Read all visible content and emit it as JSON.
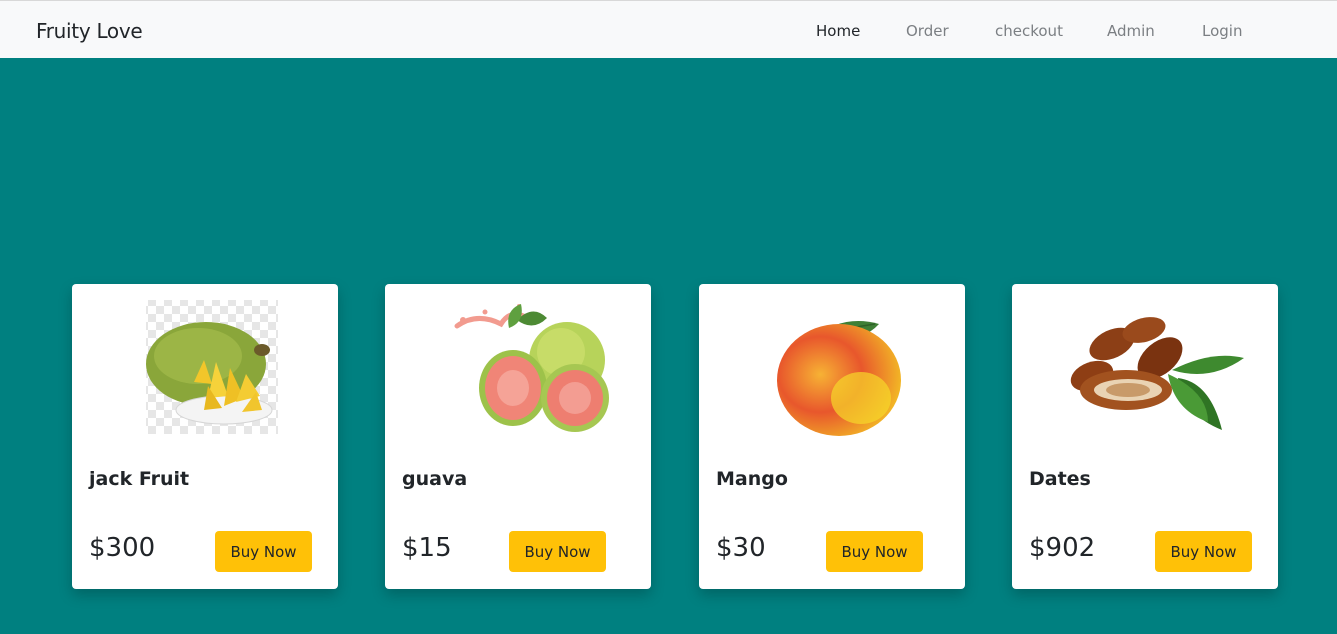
{
  "navbar": {
    "brand": "Fruity Love",
    "links": [
      {
        "label": "Home",
        "active": true
      },
      {
        "label": "Order",
        "active": false
      },
      {
        "label": "checkout",
        "active": false
      },
      {
        "label": "Admin",
        "active": false
      },
      {
        "label": "Login",
        "active": false
      }
    ]
  },
  "products": [
    {
      "name": "jack Fruit",
      "price": "$300",
      "button": "Buy Now",
      "image": "jackfruit-image"
    },
    {
      "name": "guava",
      "price": "$15",
      "button": "Buy Now",
      "image": "guava-image"
    },
    {
      "name": "Mango",
      "price": "$30",
      "button": "Buy Now",
      "image": "mango-image"
    },
    {
      "name": "Dates",
      "price": "$902",
      "button": "Buy Now",
      "image": "dates-image"
    }
  ],
  "colors": {
    "background": "#008080",
    "navbar": "#f8f9fa",
    "button": "#ffc107",
    "card": "#ffffff"
  }
}
